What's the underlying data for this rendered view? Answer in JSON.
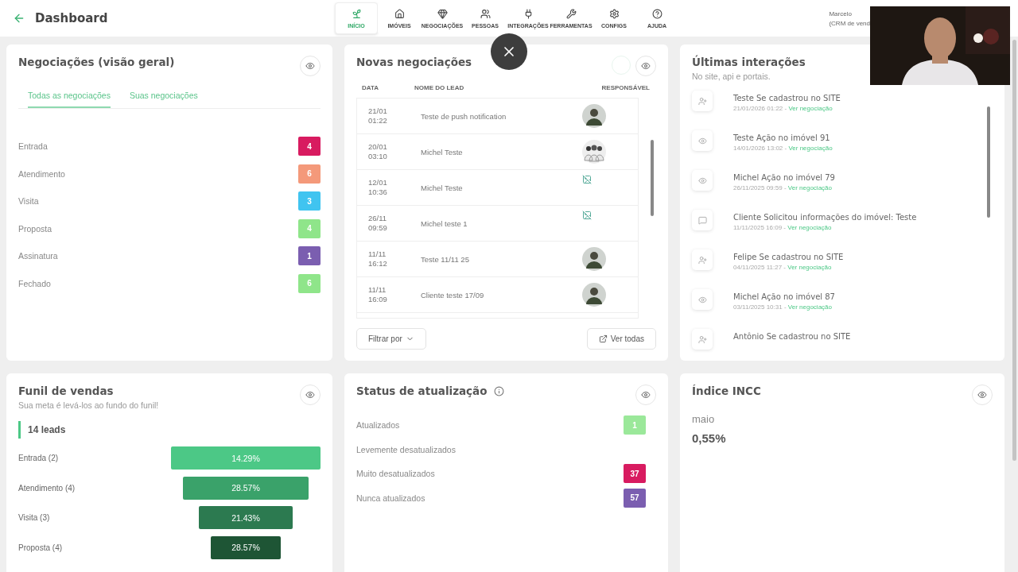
{
  "header": {
    "back_title": "Dashboard",
    "nav": [
      {
        "label": "INÍCIO",
        "kind": "sprout",
        "selected": true
      },
      {
        "label": "IMÓVEIS",
        "kind": "home",
        "selected": false
      },
      {
        "label": "NEGOCIAÇÕES",
        "kind": "gem",
        "selected": false
      },
      {
        "label": "PESSOAS",
        "kind": "users",
        "selected": false
      },
      {
        "label": "INTEGRAÇÕES",
        "kind": "plug",
        "selected": false
      },
      {
        "label": "FERRAMENTAS",
        "kind": "tools",
        "selected": false
      },
      {
        "label": "CONFIGS",
        "kind": "gear",
        "selected": false
      },
      {
        "label": "AJUDA",
        "kind": "help",
        "selected": false
      }
    ],
    "user": {
      "name": "Marcelo",
      "role": "(CRM de vend"
    }
  },
  "overview": {
    "title": "Negociações (visão geral)",
    "tabs": [
      {
        "label": "Todas as negociações",
        "selected": true
      },
      {
        "label": "Suas negociações",
        "selected": false
      }
    ],
    "stages": [
      {
        "name": "Entrada",
        "count": "4",
        "color": "#d81b60"
      },
      {
        "name": "Atendimento",
        "count": "6",
        "color": "#f4997a"
      },
      {
        "name": "Visita",
        "count": "3",
        "color": "#40c4f0"
      },
      {
        "name": "Proposta",
        "count": "4",
        "color": "#8fe58a"
      },
      {
        "name": "Assinatura",
        "count": "1",
        "color": "#7b5eb0"
      },
      {
        "name": "Fechado",
        "count": "6",
        "color": "#8fe58a"
      }
    ]
  },
  "new_deals": {
    "title": "Novas negociações",
    "columns": [
      "DATA",
      "NOME DO LEAD",
      "RESPONSÁVEL"
    ],
    "rows": [
      {
        "date": "21/01",
        "time": "01:22",
        "lead": "Teste de push notification"
      },
      {
        "date": "20/01",
        "time": "03:10",
        "lead": "Michel Teste",
        "kind": "group"
      },
      {
        "date": "12/01",
        "time": "10:36",
        "lead": "Michel Teste",
        "kind": "broken"
      },
      {
        "date": "26/11",
        "time": "09:59",
        "lead": "Michel teste 1",
        "kind": "broken"
      },
      {
        "date": "11/11",
        "time": "16:12",
        "lead": "Teste 11/11 25"
      },
      {
        "date": "11/11",
        "time": "16:09",
        "lead": "Cliente teste 17/09"
      }
    ],
    "filter_button": "Filtrar por",
    "view_all_button": "Ver todas"
  },
  "interactions": {
    "title": "Últimas interações",
    "subtitle": "No site, api e portais.",
    "items": [
      {
        "kind": "signup",
        "title": "Teste Se cadastrou no SITE",
        "date": "21/01/2026 01:22",
        "separator": "-",
        "link": "Ver negociação"
      },
      {
        "kind": "view",
        "title": "Teste Ação no imóvel 91",
        "date": "14/01/2026 13:02",
        "separator": "-",
        "link": "Ver negociação"
      },
      {
        "kind": "view",
        "title": "Michel Ação no imóvel 79",
        "date": "26/11/2025 09:59",
        "separator": "-",
        "link": "Ver negociação"
      },
      {
        "kind": "message",
        "title": "Cliente Solicitou informações do imóvel: Teste",
        "date": "11/11/2025 16:09",
        "separator": "-",
        "link": "Ver negociação"
      },
      {
        "kind": "signup",
        "title": "Felipe Se cadastrou no SITE",
        "date": "04/11/2025 11:27",
        "separator": "-",
        "link": "Ver negociação"
      },
      {
        "kind": "view",
        "title": "Michel Ação no imóvel 87",
        "date": "03/11/2025 10:31",
        "separator": "-",
        "link": "Ver negociação"
      },
      {
        "kind": "signup",
        "title": "Antônio Se cadastrou no SITE"
      }
    ]
  },
  "funnel": {
    "title": "Funil de vendas",
    "subtitle": "Sua meta é levá-los ao fundo do funil!",
    "total": "14 leads",
    "stages": [
      {
        "label": "Entrada (2)",
        "percent": "14.29%",
        "color": "#4cc886"
      },
      {
        "label": "Atendimento (4)",
        "percent": "28.57%",
        "color": "#3aa26a"
      },
      {
        "label": "Visita (3)",
        "percent": "21.43%",
        "color": "#2c7a50"
      },
      {
        "label": "Proposta (4)",
        "percent": "28.57%",
        "color": "#1e5535"
      }
    ]
  },
  "update_status": {
    "title": "Status de atualização",
    "rows": [
      {
        "label": "Atualizados",
        "count": "1",
        "color": "#9be89a"
      },
      {
        "label": "Levemente desatualizados"
      },
      {
        "label": "Muito desatualizados",
        "count": "37",
        "color": "#d81b60"
      },
      {
        "label": "Nunca atualizados",
        "count": "57",
        "color": "#7b5eb0"
      }
    ]
  },
  "incc": {
    "title": "Índice INCC",
    "month": "maio",
    "value": "0,55%"
  }
}
